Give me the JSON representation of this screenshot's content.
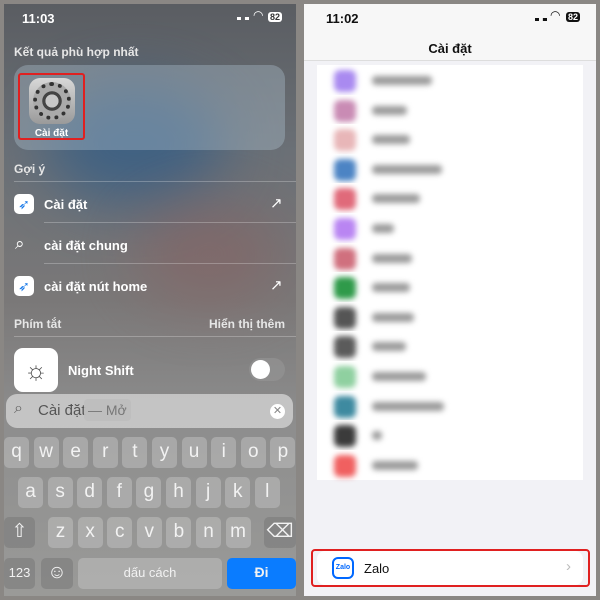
{
  "left": {
    "status": {
      "time": "11:03",
      "battery": "82"
    },
    "top_hit_header": "Kết quả phù hợp nhất",
    "top_hit": {
      "label": "Cài đặt",
      "icon": "settings-gear-icon"
    },
    "suggestions_header": "Gợi ý",
    "suggestions": [
      {
        "label": "Cài đặt",
        "icon": "safari-icon",
        "action": "arrow-up-right-icon"
      },
      {
        "label": "cài đặt chung",
        "icon": "search-icon"
      },
      {
        "label": "cài đặt nút home",
        "icon": "safari-icon",
        "action": "arrow-up-right-icon"
      }
    ],
    "shortcuts_header": "Phím tắt",
    "show_more": "Hiển thị thêm",
    "shortcut": {
      "label": "Night Shift",
      "toggle_on": false
    },
    "search": {
      "value": "Cài đặt",
      "hint": "— Mở"
    },
    "keyboard": {
      "row1": [
        "q",
        "w",
        "e",
        "r",
        "t",
        "y",
        "u",
        "i",
        "o",
        "p"
      ],
      "row2": [
        "a",
        "s",
        "d",
        "f",
        "g",
        "h",
        "j",
        "k",
        "l"
      ],
      "row3": [
        "z",
        "x",
        "c",
        "v",
        "b",
        "n",
        "m"
      ],
      "numbers": "123",
      "space": "dấu cách",
      "go": "Đi"
    }
  },
  "right": {
    "status": {
      "time": "11:02",
      "battery": "82"
    },
    "title": "Cài đặt",
    "blurred_icon_colors": [
      "#a98af0",
      "#c98bb4",
      "#e8b6b8",
      "#4c84c4",
      "#e06a7a",
      "#b985f2",
      "#d0707e",
      "#2f9a4a",
      "#555555",
      "#5b5b5b",
      "#8fd0a0",
      "#3e8aa0",
      "#3b3b3b",
      "#f06060"
    ],
    "highlight": {
      "label": "Zalo",
      "icon": "zalo-icon"
    },
    "accent": "#e02020"
  }
}
